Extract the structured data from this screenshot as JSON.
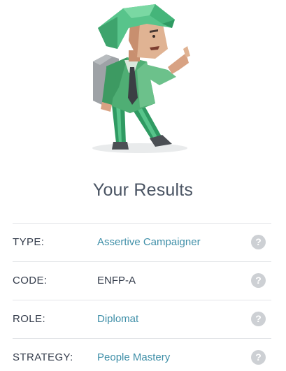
{
  "results": {
    "title": "Your Results",
    "rows": [
      {
        "label": "TYPE:",
        "value": "Assertive Campaigner",
        "value_style": "link",
        "help_glyph": "?"
      },
      {
        "label": "CODE:",
        "value": "ENFP-A",
        "value_style": "plain",
        "help_glyph": "?"
      },
      {
        "label": "ROLE:",
        "value": "Diplomat",
        "value_style": "link",
        "help_glyph": "?"
      },
      {
        "label": "STRATEGY:",
        "value": "People Mastery",
        "value_style": "link",
        "help_glyph": "?"
      }
    ]
  },
  "colors": {
    "title": "#4a5463",
    "label": "#343c4b",
    "link_value": "#3f8fa8",
    "help_icon_bg": "#cdd0d4",
    "divider": "#e3e5e8",
    "character_green": "#4fae74"
  },
  "icons": {
    "hero": "campaigner-character-illustration",
    "help": "question-circle-icon"
  }
}
